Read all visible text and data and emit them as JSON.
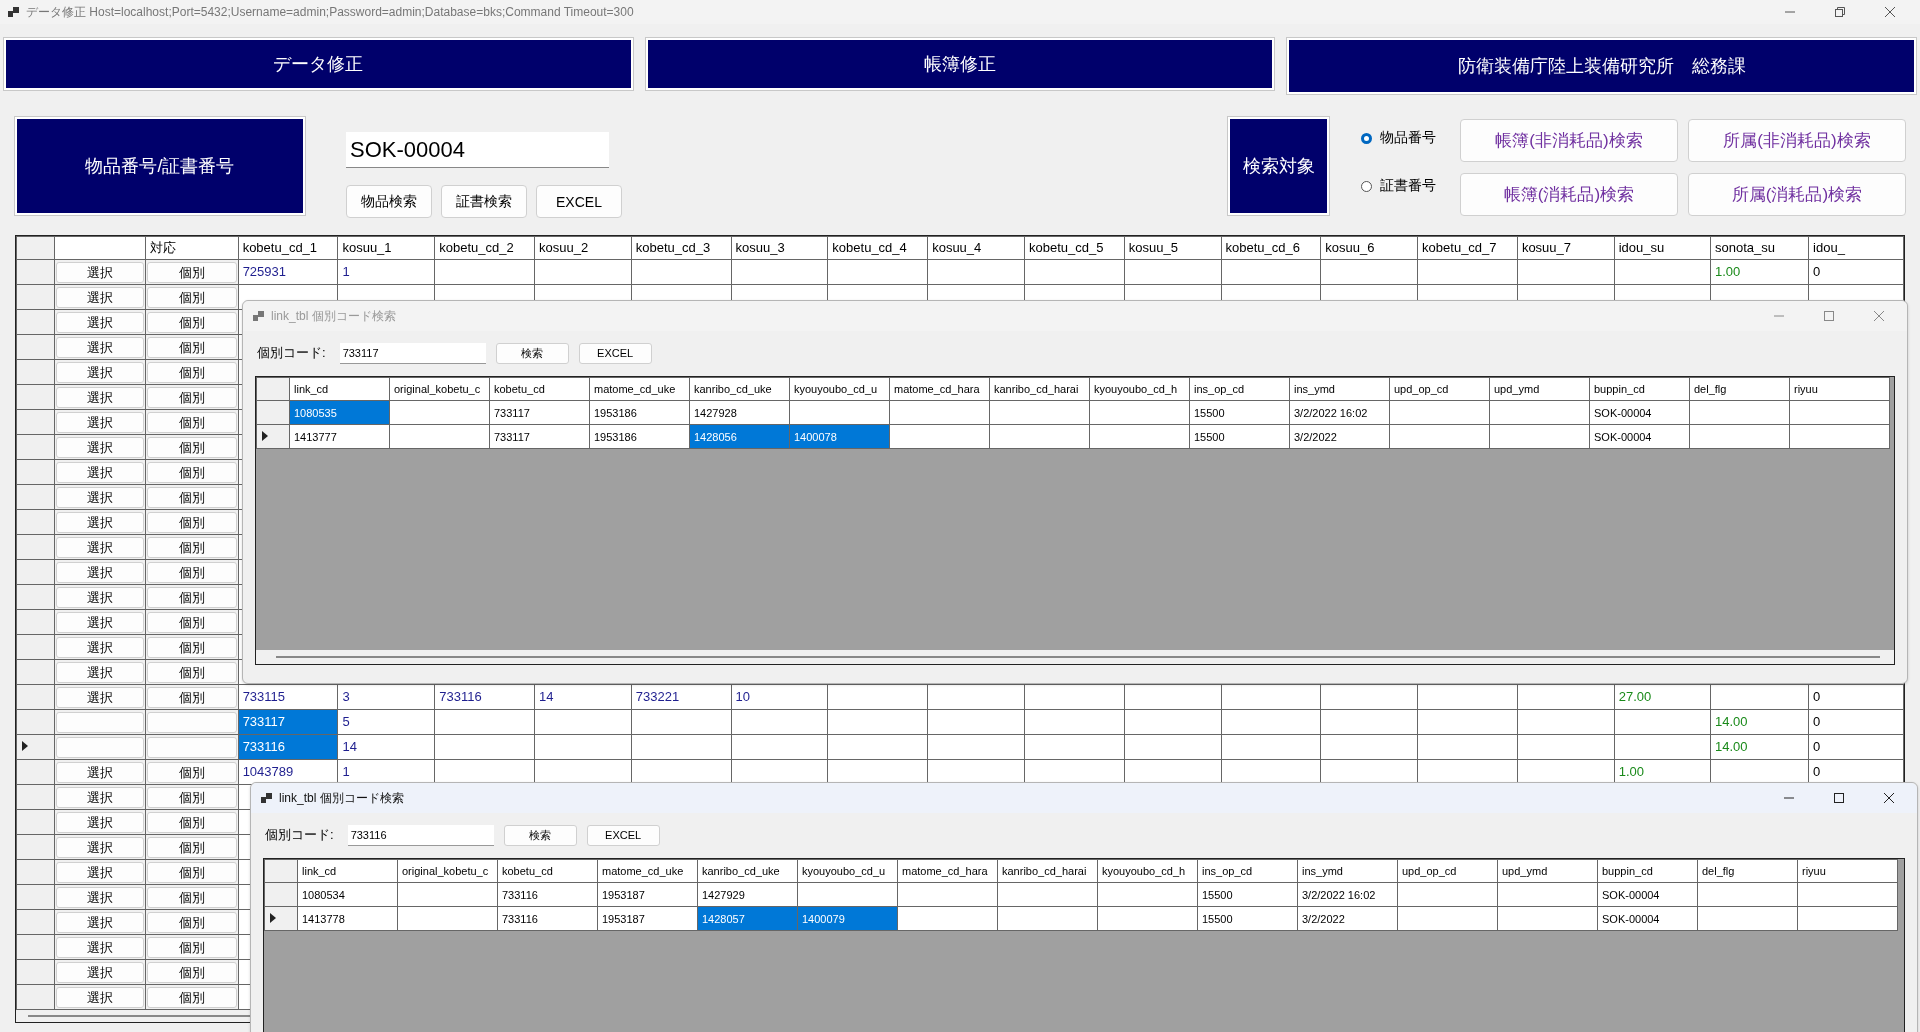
{
  "window": {
    "title": "データ修正 Host=localhost;Port=5432;Username=admin;Password=admin;Database=bks;Command Timeout=300"
  },
  "header": {
    "buttons": [
      "データ修正",
      "帳簿修正"
    ],
    "organization": "防衛装備庁陸上装備研究所　総務課"
  },
  "search": {
    "label": "物品番号/証書番号",
    "value": "SOK-00004",
    "buttons": [
      "物品検索",
      "証書検索",
      "EXCEL"
    ],
    "target_label": "検索対象",
    "target_options": [
      {
        "label": "物品番号",
        "selected": true
      },
      {
        "label": "証書番号",
        "selected": false
      }
    ],
    "search_buttons": [
      "帳簿(非消耗品)検索",
      "所属(非消耗品)検索",
      "帳簿(消耗品)検索",
      "所属(消耗品)検索"
    ]
  },
  "main_grid": {
    "columns": [
      {
        "kind": "action"
      },
      {
        "label": "対応",
        "kind": "action"
      },
      {
        "label": "kobetu_cd_1",
        "kind": "code"
      },
      {
        "label": "kosuu_1",
        "kind": "code"
      },
      {
        "label": "kobetu_cd_2",
        "kind": "code"
      },
      {
        "label": "kosuu_2",
        "kind": "code"
      },
      {
        "label": "kobetu_cd_3",
        "kind": "code"
      },
      {
        "label": "kosuu_3",
        "kind": "code"
      },
      {
        "label": "kobetu_cd_4",
        "kind": "code"
      },
      {
        "label": "kosuu_4",
        "kind": "code"
      },
      {
        "label": "kobetu_cd_5",
        "kind": "code"
      },
      {
        "label": "kosuu_5",
        "kind": "code"
      },
      {
        "label": "kobetu_cd_6",
        "kind": "code"
      },
      {
        "label": "kosuu_6",
        "kind": "code"
      },
      {
        "label": "kobetu_cd_7",
        "kind": "code"
      },
      {
        "label": "kosuu_7",
        "kind": "code"
      },
      {
        "label": "idou_su",
        "kind": "amount"
      },
      {
        "label": "sonota_su",
        "kind": "amount"
      },
      {
        "label": "idou_",
        "kind": "plain"
      }
    ],
    "rows": [
      {
        "kind": "action",
        "buttons": [
          "選択",
          "個別"
        ],
        "selected": false,
        "current": false,
        "cells": [
          "725931",
          "1",
          null,
          null,
          null,
          null,
          null,
          null,
          null,
          null,
          null,
          null,
          null,
          null,
          null,
          "1.00",
          "0"
        ]
      },
      {
        "kind": "action",
        "buttons": [
          "選択",
          "個別"
        ],
        "selected": false,
        "current": false
      },
      {
        "kind": "action",
        "buttons": [
          "選択",
          "個別"
        ],
        "selected": false,
        "current": false
      },
      {
        "kind": "action",
        "buttons": [
          "選択",
          "個別"
        ],
        "selected": false,
        "current": false
      },
      {
        "kind": "action",
        "buttons": [
          "選択",
          "個別"
        ],
        "selected": false,
        "current": false
      },
      {
        "kind": "action",
        "buttons": [
          "選択",
          "個別"
        ],
        "selected": false,
        "current": false
      },
      {
        "kind": "action",
        "buttons": [
          "選択",
          "個別"
        ],
        "selected": false,
        "current": false
      },
      {
        "kind": "action",
        "buttons": [
          "選択",
          "個別"
        ],
        "selected": false,
        "current": false
      },
      {
        "kind": "action",
        "buttons": [
          "選択",
          "個別"
        ],
        "selected": false,
        "current": false
      },
      {
        "kind": "action",
        "buttons": [
          "選択",
          "個別"
        ],
        "selected": false,
        "current": false
      },
      {
        "kind": "action",
        "buttons": [
          "選択",
          "個別"
        ],
        "selected": false,
        "current": false
      },
      {
        "kind": "action",
        "buttons": [
          "選択",
          "個別"
        ],
        "selected": false,
        "current": false
      },
      {
        "kind": "action",
        "buttons": [
          "選択",
          "個別"
        ],
        "selected": false,
        "current": false
      },
      {
        "kind": "action",
        "buttons": [
          "選択",
          "個別"
        ],
        "selected": false,
        "current": false
      },
      {
        "kind": "action",
        "buttons": [
          "選択",
          "個別"
        ],
        "selected": false,
        "current": false
      },
      {
        "kind": "action",
        "buttons": [
          "選択",
          "個別"
        ],
        "selected": false,
        "current": false
      },
      {
        "kind": "action",
        "buttons": [
          "選択",
          "個別"
        ],
        "selected": false,
        "current": false
      },
      {
        "kind": "action",
        "buttons": [
          "選択",
          "個別"
        ],
        "selected": false,
        "current": false,
        "cells": [
          "733115",
          "3",
          "733116",
          "14",
          "733221",
          "10",
          null,
          null,
          null,
          null,
          null,
          null,
          null,
          null,
          "27.00",
          null,
          "0"
        ]
      },
      {
        "kind": "blank",
        "selected": true,
        "current": false,
        "cells": [
          "733117",
          "5",
          null,
          null,
          null,
          null,
          null,
          null,
          null,
          null,
          null,
          null,
          null,
          null,
          null,
          "14.00",
          "0"
        ]
      },
      {
        "kind": "blank",
        "selected": true,
        "current": true,
        "cells": [
          "733116",
          "14",
          null,
          null,
          null,
          null,
          null,
          null,
          null,
          null,
          null,
          null,
          null,
          null,
          null,
          "14.00",
          "0"
        ]
      },
      {
        "kind": "action",
        "buttons": [
          "選択",
          "個別"
        ],
        "selected": false,
        "current": false,
        "cells": [
          "1043789",
          "1",
          null,
          null,
          null,
          null,
          null,
          null,
          null,
          null,
          null,
          null,
          null,
          null,
          "1.00",
          null,
          "0"
        ]
      },
      {
        "kind": "action",
        "buttons": [
          "選択",
          "個別"
        ],
        "selected": false,
        "current": false
      },
      {
        "kind": "action",
        "buttons": [
          "選択",
          "個別"
        ],
        "selected": false,
        "current": false
      },
      {
        "kind": "action",
        "buttons": [
          "選択",
          "個別"
        ],
        "selected": false,
        "current": false
      },
      {
        "kind": "action",
        "buttons": [
          "選択",
          "個別"
        ],
        "selected": false,
        "current": false
      },
      {
        "kind": "action",
        "buttons": [
          "選択",
          "個別"
        ],
        "selected": false,
        "current": false
      },
      {
        "kind": "action",
        "buttons": [
          "選択",
          "個別"
        ],
        "selected": false,
        "current": false
      },
      {
        "kind": "action",
        "buttons": [
          "選択",
          "個別"
        ],
        "selected": false,
        "current": false
      },
      {
        "kind": "action",
        "buttons": [
          "選択",
          "個別"
        ],
        "selected": false,
        "current": false
      },
      {
        "kind": "action",
        "buttons": [
          "選択",
          "個別"
        ],
        "selected": false,
        "current": false
      }
    ]
  },
  "dialogs": [
    {
      "title": "link_tbl 個別コード検索",
      "active": false,
      "field_label": "個別コード:",
      "field_value": "733117",
      "buttons": [
        "検索",
        "EXCEL"
      ],
      "columns": [
        "link_cd",
        "original_kobetu_c",
        "kobetu_cd",
        "matome_cd_uke",
        "kanribo_cd_uke",
        "kyouyoubo_cd_u",
        "matome_cd_hara",
        "kanribo_cd_harai",
        "kyouyoubo_cd_h",
        "ins_op_cd",
        "ins_ymd",
        "upd_op_cd",
        "upd_ymd",
        "buppin_cd",
        "del_flg",
        "riyuu"
      ],
      "rows": [
        {
          "current": false,
          "cells": [
            {
              "text": "1080535",
              "selected": true
            },
            {
              "selected": false
            },
            {
              "text": "733117",
              "selected": false
            },
            {
              "text": "1953186",
              "selected": false
            },
            {
              "text": "1427928",
              "selected": false
            },
            {
              "selected": false
            },
            {
              "selected": false
            },
            {
              "selected": false
            },
            {
              "selected": false
            },
            {
              "text": "15500",
              "selected": false
            },
            {
              "text": "3/2/2022 16:02",
              "selected": false
            },
            {
              "selected": false
            },
            {
              "selected": false
            },
            {
              "text": "SOK-00004",
              "selected": false
            },
            {
              "selected": false
            },
            {
              "selected": false
            }
          ]
        },
        {
          "current": true,
          "cells": [
            {
              "text": "1413777",
              "selected": false
            },
            {
              "selected": false
            },
            {
              "text": "733117",
              "selected": false
            },
            {
              "text": "1953186",
              "selected": false
            },
            {
              "text": "1428056",
              "selected": true
            },
            {
              "text": "1400078",
              "selected": true
            },
            {
              "selected": false
            },
            {
              "selected": false
            },
            {
              "selected": false
            },
            {
              "text": "15500",
              "selected": false
            },
            {
              "text": "3/2/2022",
              "selected": false
            },
            {
              "selected": false
            },
            {
              "selected": false
            },
            {
              "text": "SOK-00004",
              "selected": false
            },
            {
              "selected": false
            },
            {
              "selected": false
            }
          ]
        }
      ]
    },
    {
      "title": "link_tbl 個別コード検索",
      "active": true,
      "field_label": "個別コード:",
      "field_value": "733116",
      "buttons": [
        "検索",
        "EXCEL"
      ],
      "columns": [
        "link_cd",
        "original_kobetu_c",
        "kobetu_cd",
        "matome_cd_uke",
        "kanribo_cd_uke",
        "kyouyoubo_cd_u",
        "matome_cd_hara",
        "kanribo_cd_harai",
        "kyouyoubo_cd_h",
        "ins_op_cd",
        "ins_ymd",
        "upd_op_cd",
        "upd_ymd",
        "buppin_cd",
        "del_flg",
        "riyuu"
      ],
      "rows": [
        {
          "current": false,
          "cells": [
            {
              "text": "1080534",
              "selected": false
            },
            {
              "selected": false
            },
            {
              "text": "733116",
              "selected": false
            },
            {
              "text": "1953187",
              "selected": false
            },
            {
              "text": "1427929",
              "selected": false
            },
            {
              "selected": false
            },
            {
              "selected": false
            },
            {
              "selected": false
            },
            {
              "selected": false
            },
            {
              "text": "15500",
              "selected": false
            },
            {
              "text": "3/2/2022 16:02",
              "selected": false
            },
            {
              "selected": false
            },
            {
              "selected": false
            },
            {
              "text": "SOK-00004",
              "selected": false
            },
            {
              "selected": false
            },
            {
              "selected": false
            }
          ]
        },
        {
          "current": true,
          "cells": [
            {
              "text": "1413778",
              "selected": false
            },
            {
              "selected": false
            },
            {
              "text": "733116",
              "selected": false
            },
            {
              "text": "1953187",
              "selected": false
            },
            {
              "text": "1428057",
              "selected": true
            },
            {
              "text": "1400079",
              "selected": true
            },
            {
              "selected": false
            },
            {
              "selected": false
            },
            {
              "selected": false
            },
            {
              "text": "15500",
              "selected": false
            },
            {
              "text": "3/2/2022",
              "selected": false
            },
            {
              "selected": false
            },
            {
              "selected": false
            },
            {
              "text": "SOK-00004",
              "selected": false
            },
            {
              "selected": false
            },
            {
              "selected": false
            }
          ]
        }
      ]
    }
  ]
}
